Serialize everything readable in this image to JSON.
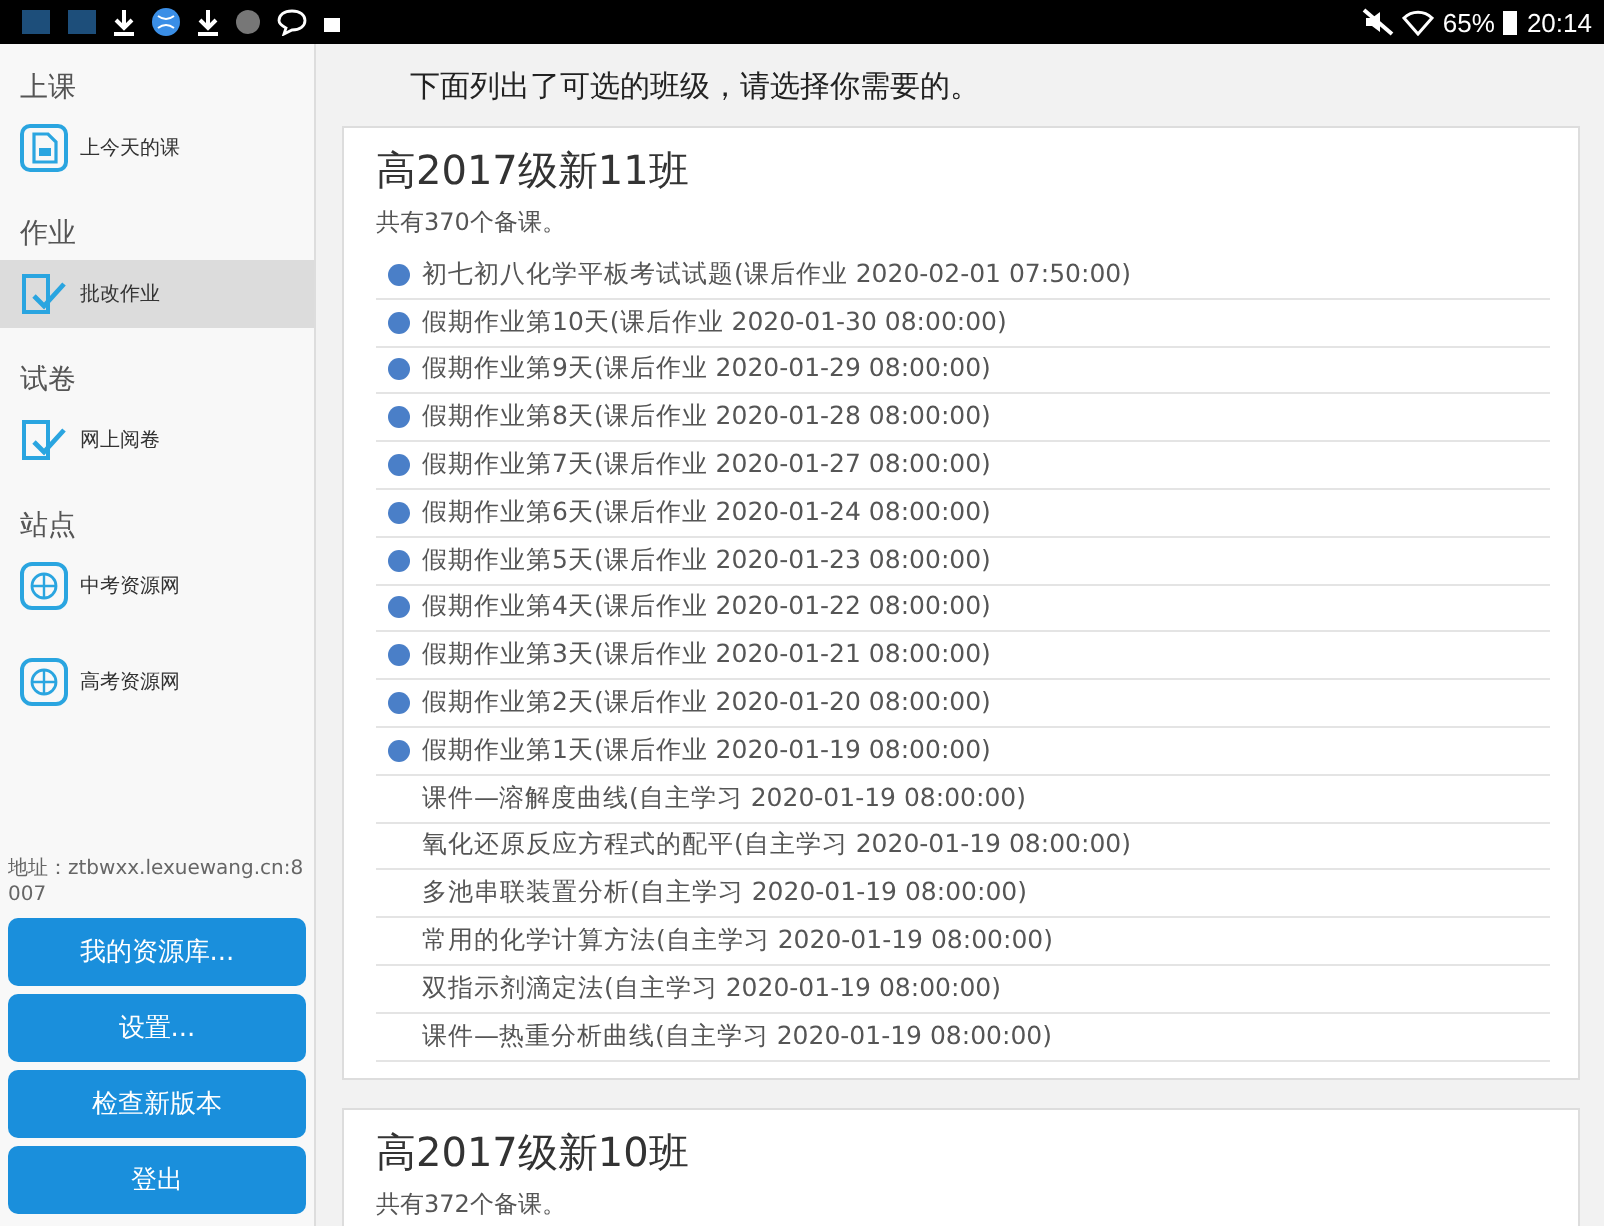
{
  "status_bar": {
    "battery": "65%",
    "time": "20:14"
  },
  "sidebar": {
    "sections": [
      {
        "heading": "上课",
        "items": [
          {
            "label": "上今天的课",
            "kind": "lesson",
            "selected": false
          }
        ]
      },
      {
        "heading": "作业",
        "items": [
          {
            "label": "批改作业",
            "kind": "check",
            "selected": true
          }
        ]
      },
      {
        "heading": "试卷",
        "items": [
          {
            "label": "网上阅卷",
            "kind": "check",
            "selected": false
          }
        ]
      },
      {
        "heading": "站点",
        "items": [
          {
            "label": "中考资源网",
            "kind": "globe",
            "selected": false
          },
          {
            "label": "高考资源网",
            "kind": "globe",
            "selected": false
          }
        ]
      }
    ],
    "address": "地址：ztbwxx.lexuewang.cn:8007",
    "buttons": [
      "我的资源库...",
      "设置...",
      "检查新版本",
      "登出"
    ]
  },
  "instruction": "下面列出了可选的班级，请选择你需要的。",
  "classes": [
    {
      "title": "高2017级新11班",
      "count": "共有370个备课。",
      "lessons": [
        {
          "text": "初七初八化学平板考试试题(课后作业 2020-02-01 07:50:00)",
          "kind": "homework"
        },
        {
          "text": "假期作业第10天(课后作业 2020-01-30 08:00:00)",
          "kind": "homework"
        },
        {
          "text": "假期作业第9天(课后作业 2020-01-29 08:00:00)",
          "kind": "homework"
        },
        {
          "text": "假期作业第8天(课后作业 2020-01-28 08:00:00)",
          "kind": "homework"
        },
        {
          "text": "假期作业第7天(课后作业 2020-01-27 08:00:00)",
          "kind": "homework"
        },
        {
          "text": "假期作业第6天(课后作业 2020-01-24 08:00:00)",
          "kind": "homework"
        },
        {
          "text": "假期作业第5天(课后作业 2020-01-23 08:00:00)",
          "kind": "homework"
        },
        {
          "text": "假期作业第4天(课后作业 2020-01-22 08:00:00)",
          "kind": "homework"
        },
        {
          "text": "假期作业第3天(课后作业 2020-01-21 08:00:00)",
          "kind": "homework"
        },
        {
          "text": "假期作业第2天(课后作业 2020-01-20 08:00:00)",
          "kind": "homework"
        },
        {
          "text": "假期作业第1天(课后作业 2020-01-19 08:00:00)",
          "kind": "homework"
        },
        {
          "text": "课件—溶解度曲线(自主学习 2020-01-19 08:00:00)",
          "kind": "self"
        },
        {
          "text": "氧化还原反应方程式的配平(自主学习 2020-01-19 08:00:00)",
          "kind": "self"
        },
        {
          "text": "多池串联装置分析(自主学习 2020-01-19 08:00:00)",
          "kind": "self"
        },
        {
          "text": "常用的化学计算方法(自主学习 2020-01-19 08:00:00)",
          "kind": "self"
        },
        {
          "text": "双指示剂滴定法(自主学习 2020-01-19 08:00:00)",
          "kind": "self"
        },
        {
          "text": "课件—热重分析曲线(自主学习 2020-01-19 08:00:00)",
          "kind": "self"
        }
      ]
    },
    {
      "title": "高2017级新10班",
      "count": "共有372个备课。"
    }
  ]
}
